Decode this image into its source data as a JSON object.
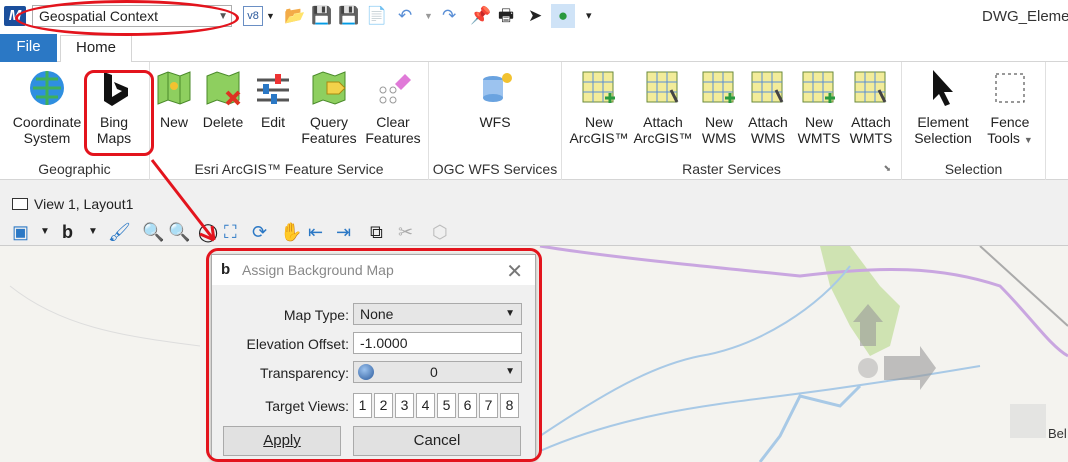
{
  "qat": {
    "workflow": "Geospatial Context",
    "title": "DWG_Elemen"
  },
  "tabs": {
    "file": "File",
    "home": "Home"
  },
  "groups": {
    "geographic": "Geographic",
    "esri": "Esri ArcGIS™ Feature Service",
    "ogc": "OGC WFS Services",
    "raster": "Raster Services",
    "selection": "Selection"
  },
  "buttons": {
    "coord": [
      "Coordinate",
      "System"
    ],
    "bing": [
      "Bing",
      "Maps"
    ],
    "new": "New",
    "delete": "Delete",
    "edit": "Edit",
    "query": [
      "Query",
      "Features"
    ],
    "clear": [
      "Clear",
      "Features"
    ],
    "wfs": "WFS",
    "new_arcgis": [
      "New",
      "ArcGIS™"
    ],
    "attach_arcgis": [
      "Attach",
      "ArcGIS™"
    ],
    "new_wms": [
      "New",
      "WMS"
    ],
    "attach_wms": [
      "Attach",
      "WMS"
    ],
    "new_wmts": [
      "New",
      "WMTS"
    ],
    "attach_wmts": [
      "Attach",
      "WMTS"
    ],
    "element_sel": [
      "Element",
      "Selection"
    ],
    "fence": [
      "Fence",
      "Tools"
    ]
  },
  "view": {
    "title": "View 1, Layout1"
  },
  "map": {
    "label": "Bel"
  },
  "dialog": {
    "title": "Assign Background Map",
    "map_type_label": "Map Type:",
    "map_type": "None",
    "elev_label": "Elevation Offset:",
    "elev": "-1.0000",
    "transp_label": "Transparency:",
    "transp": "0",
    "views_label": "Target Views:",
    "views": [
      "1",
      "2",
      "3",
      "4",
      "5",
      "6",
      "7",
      "8"
    ],
    "apply": "Apply",
    "cancel": "Cancel"
  },
  "colors": {
    "accent": "#2b78c5",
    "highlight": "#e3141d"
  }
}
